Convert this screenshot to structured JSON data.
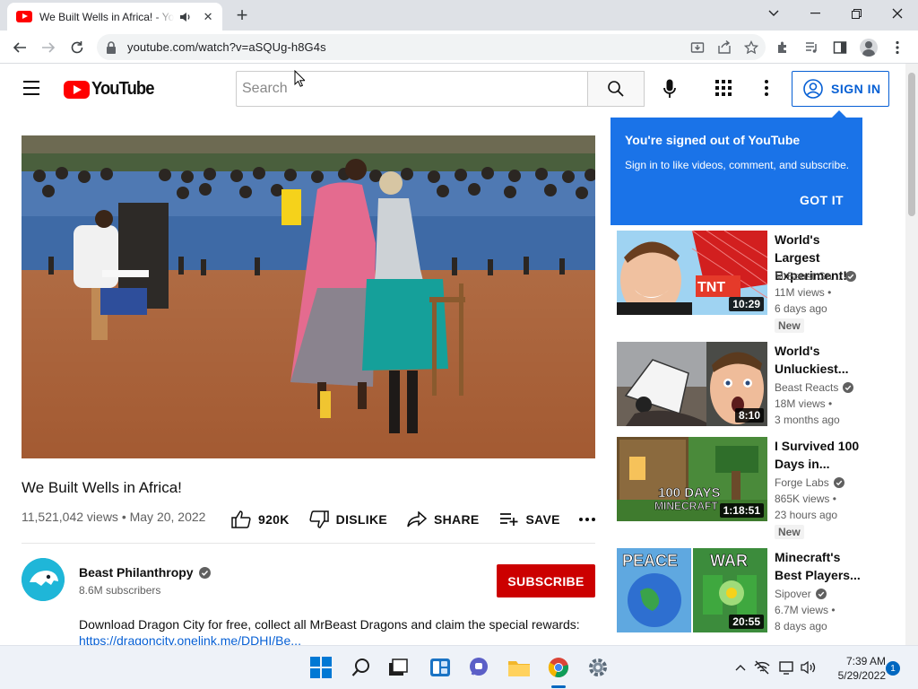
{
  "browser": {
    "tab_title": "We Built Wells in Africa! - YouTube",
    "url": "youtube.com/watch?v=aSQUg-h8G4s"
  },
  "header": {
    "logo_text": "YouTube",
    "search_placeholder": "Search",
    "sign_in_label": "SIGN IN"
  },
  "popup": {
    "title": "You're signed out of YouTube",
    "body": "Sign in to like videos, comment, and subscribe.",
    "button": "GOT IT"
  },
  "video": {
    "title": "We Built Wells in Africa!",
    "meta": "11,521,042 views • May 20, 2022",
    "likes": "920K",
    "dislike_label": "DISLIKE",
    "share_label": "SHARE",
    "save_label": "SAVE"
  },
  "channel": {
    "name": "Beast Philanthropy",
    "subscribers": "8.6M subscribers",
    "subscribe_label": "SUBSCRIBE"
  },
  "description": {
    "text": "Download Dragon City for free, collect all MrBeast Dragons and claim the special rewards:",
    "link": "https://dragoncity.onelink.me/DDHI/Be..."
  },
  "recommendations": [
    {
      "title": "World's Largest Experiment!",
      "channel": "MrBeast Ga...",
      "views": "11M views •",
      "age": "6 days ago",
      "badge": "New",
      "duration": "10:29",
      "thumb_text": "TNT"
    },
    {
      "title": "World's Unluckiest...",
      "channel": "Beast Reacts",
      "views": "18M views •",
      "age": "3 months ago",
      "badge": "",
      "duration": "8:10",
      "thumb_text": ""
    },
    {
      "title": "I Survived 100 Days in...",
      "channel": "Forge Labs",
      "views": "865K views •",
      "age": "23 hours ago",
      "badge": "New",
      "duration": "1:18:51",
      "thumb_text": "100 DAYS",
      "thumb_subtext": "MINECRAFT"
    },
    {
      "title": "Minecraft's Best Players...",
      "channel": "Sipover",
      "views": "6.7M views •",
      "age": "8 days ago",
      "badge": "",
      "duration": "20:55",
      "thumb_text": "PEACE",
      "thumb_text2": "WAR"
    }
  ],
  "taskbar": {
    "time": "7:39 AM",
    "date": "5/29/2022",
    "notifications": "1"
  },
  "colors": {
    "youtube_red": "#ff0000",
    "subscribe_red": "#cc0000",
    "link_blue": "#065fd4",
    "popup_blue": "#1a73e8"
  }
}
